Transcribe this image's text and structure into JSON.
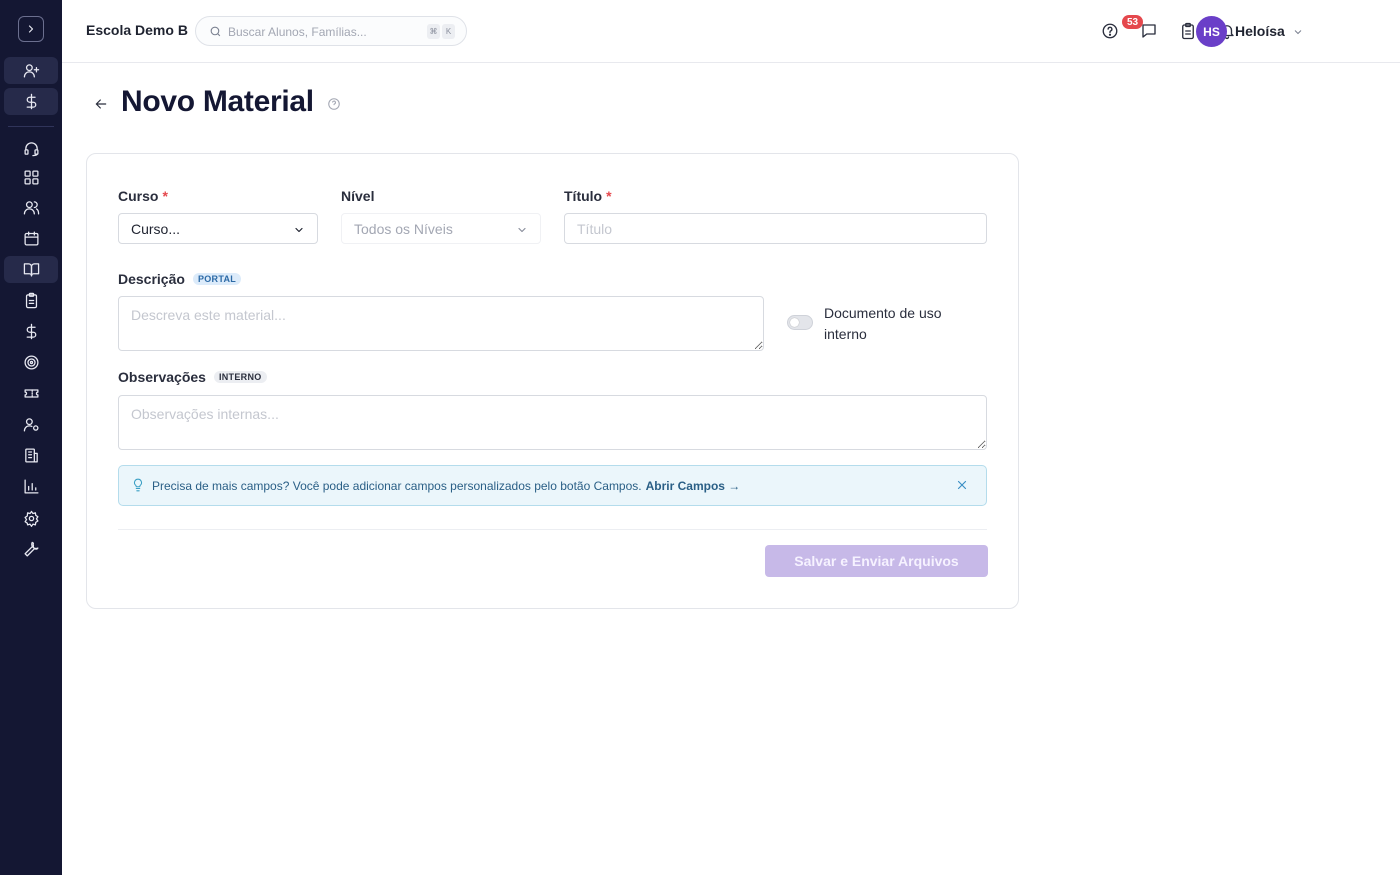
{
  "sidebar": {
    "toggle_icon": "chevron-right-icon",
    "items": [
      {
        "icon": "user-plus-icon"
      },
      {
        "icon": "dollar-icon"
      },
      {
        "icon": "headset-icon"
      },
      {
        "icon": "dashboard-icon"
      },
      {
        "icon": "users-icon"
      },
      {
        "icon": "calendar-icon"
      },
      {
        "icon": "book-open-icon"
      },
      {
        "icon": "clipboard-icon"
      },
      {
        "icon": "dollar-icon"
      },
      {
        "icon": "target-icon"
      },
      {
        "icon": "ticket-icon"
      },
      {
        "icon": "user-cog-icon"
      },
      {
        "icon": "building-icon"
      },
      {
        "icon": "bar-chart-icon"
      },
      {
        "icon": "gear-icon"
      },
      {
        "icon": "wrench-icon"
      }
    ]
  },
  "topbar": {
    "school_name": "Escola Demo B",
    "search_placeholder": "Buscar Alunos, Famílias...",
    "shortcut_keys": [
      "⌘",
      "K"
    ],
    "notification_count": "53",
    "user_initials": "HS",
    "user_name": "Heloísa"
  },
  "page": {
    "title": "Novo Material"
  },
  "form": {
    "curso_label": "Curso",
    "curso_value": "Curso...",
    "required_mark": "*",
    "nivel_label": "Nível",
    "nivel_value": "Todos os Níveis",
    "titulo_label": "Título",
    "titulo_placeholder": "Título",
    "descricao_label": "Descrição",
    "descricao_tag": "PORTAL",
    "descricao_placeholder": "Descreva este material...",
    "internal_toggle_label": "Documento de uso interno",
    "observacoes_label": "Observações",
    "observacoes_tag": "INTERNO",
    "observacoes_placeholder": "Observações internas...",
    "notice_text": "Precisa de mais campos? Você pode adicionar campos personalizados pelo botão Campos.",
    "notice_link": "Abrir Campos →",
    "save_button": "Salvar e Enviar Arquivos"
  },
  "colors": {
    "sidebar_bg": "#141733",
    "accent": "#6a3fc8",
    "badge": "#e5484d",
    "save_disabled": "#c7b9e8"
  }
}
